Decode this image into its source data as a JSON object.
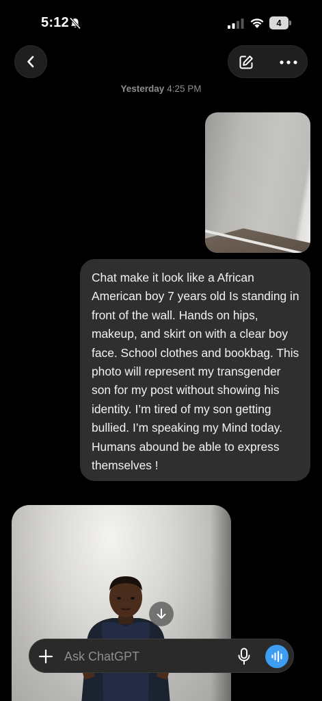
{
  "status_bar": {
    "time": "5:12",
    "battery_level": "4",
    "icons": [
      "bell-slash-icon",
      "cellular-signal-icon",
      "wifi-icon",
      "battery-icon"
    ]
  },
  "header": {
    "icons": [
      "chevron-left-icon",
      "edit-icon",
      "more-horizontal-icon"
    ]
  },
  "conversation": {
    "timestamp_day": "Yesterday",
    "timestamp_time": "4:25 PM",
    "user_message": "Chat make it look like a African American boy 7 years old Is standing in front of the wall. Hands on hips, makeup, and skirt on with a clear boy face. School clothes and bookbag. This photo will represent my transgender son for my post without showing his identity. I’m tired of my son getting bullied. I’m speaking my Mind today. Humans abound be able to express themselves !"
  },
  "composer": {
    "placeholder": "Ask ChatGPT",
    "icons": [
      "plus-icon",
      "microphone-icon",
      "voice-waveform-icon"
    ]
  },
  "colors": {
    "background": "#000000",
    "bubble": "#2f2f2f",
    "control": "#1f1f1f",
    "accent": "#3d9df3",
    "muted_text": "#8e8e93"
  }
}
